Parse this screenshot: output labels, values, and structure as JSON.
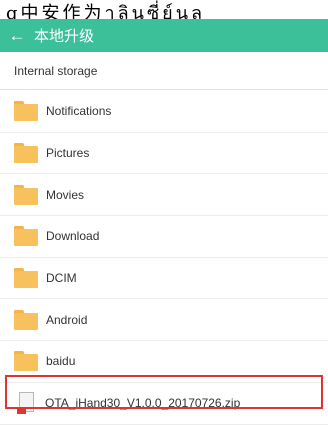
{
  "caption": "g中安作为าลินซี่ย์นล",
  "appbar": {
    "back_icon": "arrow-left-icon",
    "title": "本地升级",
    "background": "#3bc09a"
  },
  "path": "Internal storage",
  "folders": [
    {
      "name": "Notifications"
    },
    {
      "name": "Pictures"
    },
    {
      "name": "Movies"
    },
    {
      "name": "Download"
    },
    {
      "name": "DCIM"
    },
    {
      "name": "Android"
    },
    {
      "name": "baidu"
    }
  ],
  "file": {
    "name": "OTA_iHand30_V1.0.0_20170726.zip",
    "highlight_color": "#e23333"
  }
}
